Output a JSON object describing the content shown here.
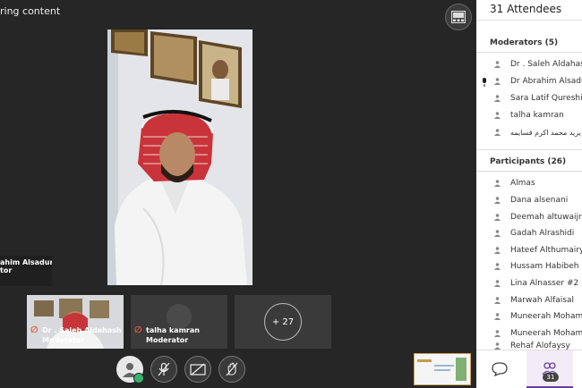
{
  "stage": {
    "share_label": "ring content",
    "main_tile": {
      "name": "ahim Alsaduni",
      "role": "tor"
    },
    "tiles": [
      {
        "name": "Dr . Saleh Aldahash",
        "role": "Moderator"
      },
      {
        "name": "talha kamran",
        "role": "Moderator"
      }
    ],
    "more_count": "+ 27"
  },
  "panel": {
    "title": "31 Attendees",
    "moderators_heading": "Moderators (5)",
    "moderators": [
      "Dr . Saleh Aldahas",
      "Dr Abrahim Alsadu",
      "Sara Latif Qureshi",
      "talha kamran",
      "يزيد محمد اكرم قسايمه"
    ],
    "participants_heading": "Participants (26)",
    "participants": [
      "Almas",
      "Dana alsenani",
      "Deemah altuwaijri",
      "Gadah Alrashidi",
      "Hateef Althumairy",
      "Hussam Habibeh",
      "Lina Alnasser #2",
      "Marwah Alfaisal",
      "Muneerah Moham",
      "Muneerah Moham",
      "Rehaf Alofaysy"
    ],
    "attendee_badge": "31"
  },
  "colors": {
    "stage_bg": "#262626",
    "accent_purple": "#6a3fa0",
    "mic_off": "#e05a3a",
    "status_green": "#37b36b"
  },
  "icons": {
    "layout": "layout-icon",
    "microphone": "microphone-icon",
    "camera": "camera-icon",
    "hand": "hand-icon",
    "chat": "chat-icon",
    "attendees": "attendees-icon"
  }
}
